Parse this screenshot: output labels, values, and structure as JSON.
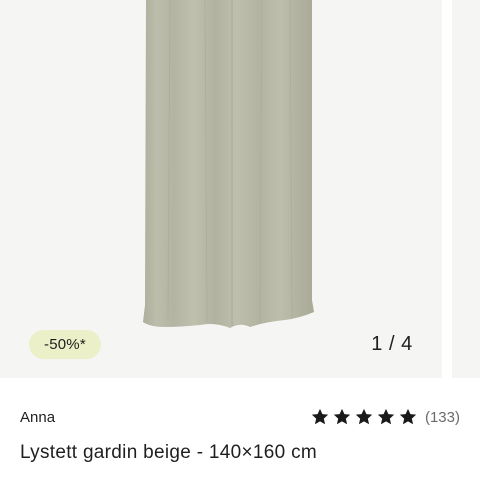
{
  "gallery": {
    "badge": "-50%*",
    "counter": "1 / 4",
    "current_slide": 1,
    "total_slides": 4
  },
  "product": {
    "brand": "Anna",
    "title": "Lystett gardin beige - 140×160 cm",
    "rating": {
      "stars": 5,
      "max_stars": 5,
      "count_label": "(133)"
    }
  },
  "colors": {
    "badge_background": "#ebf0c8",
    "curtain": "#b9b9a7",
    "image_background": "#f5f5f4",
    "star": "#1a1a1a",
    "text": "#1f1f1f",
    "muted_text": "#6b6b6b"
  },
  "icons": [
    "star-icon"
  ]
}
